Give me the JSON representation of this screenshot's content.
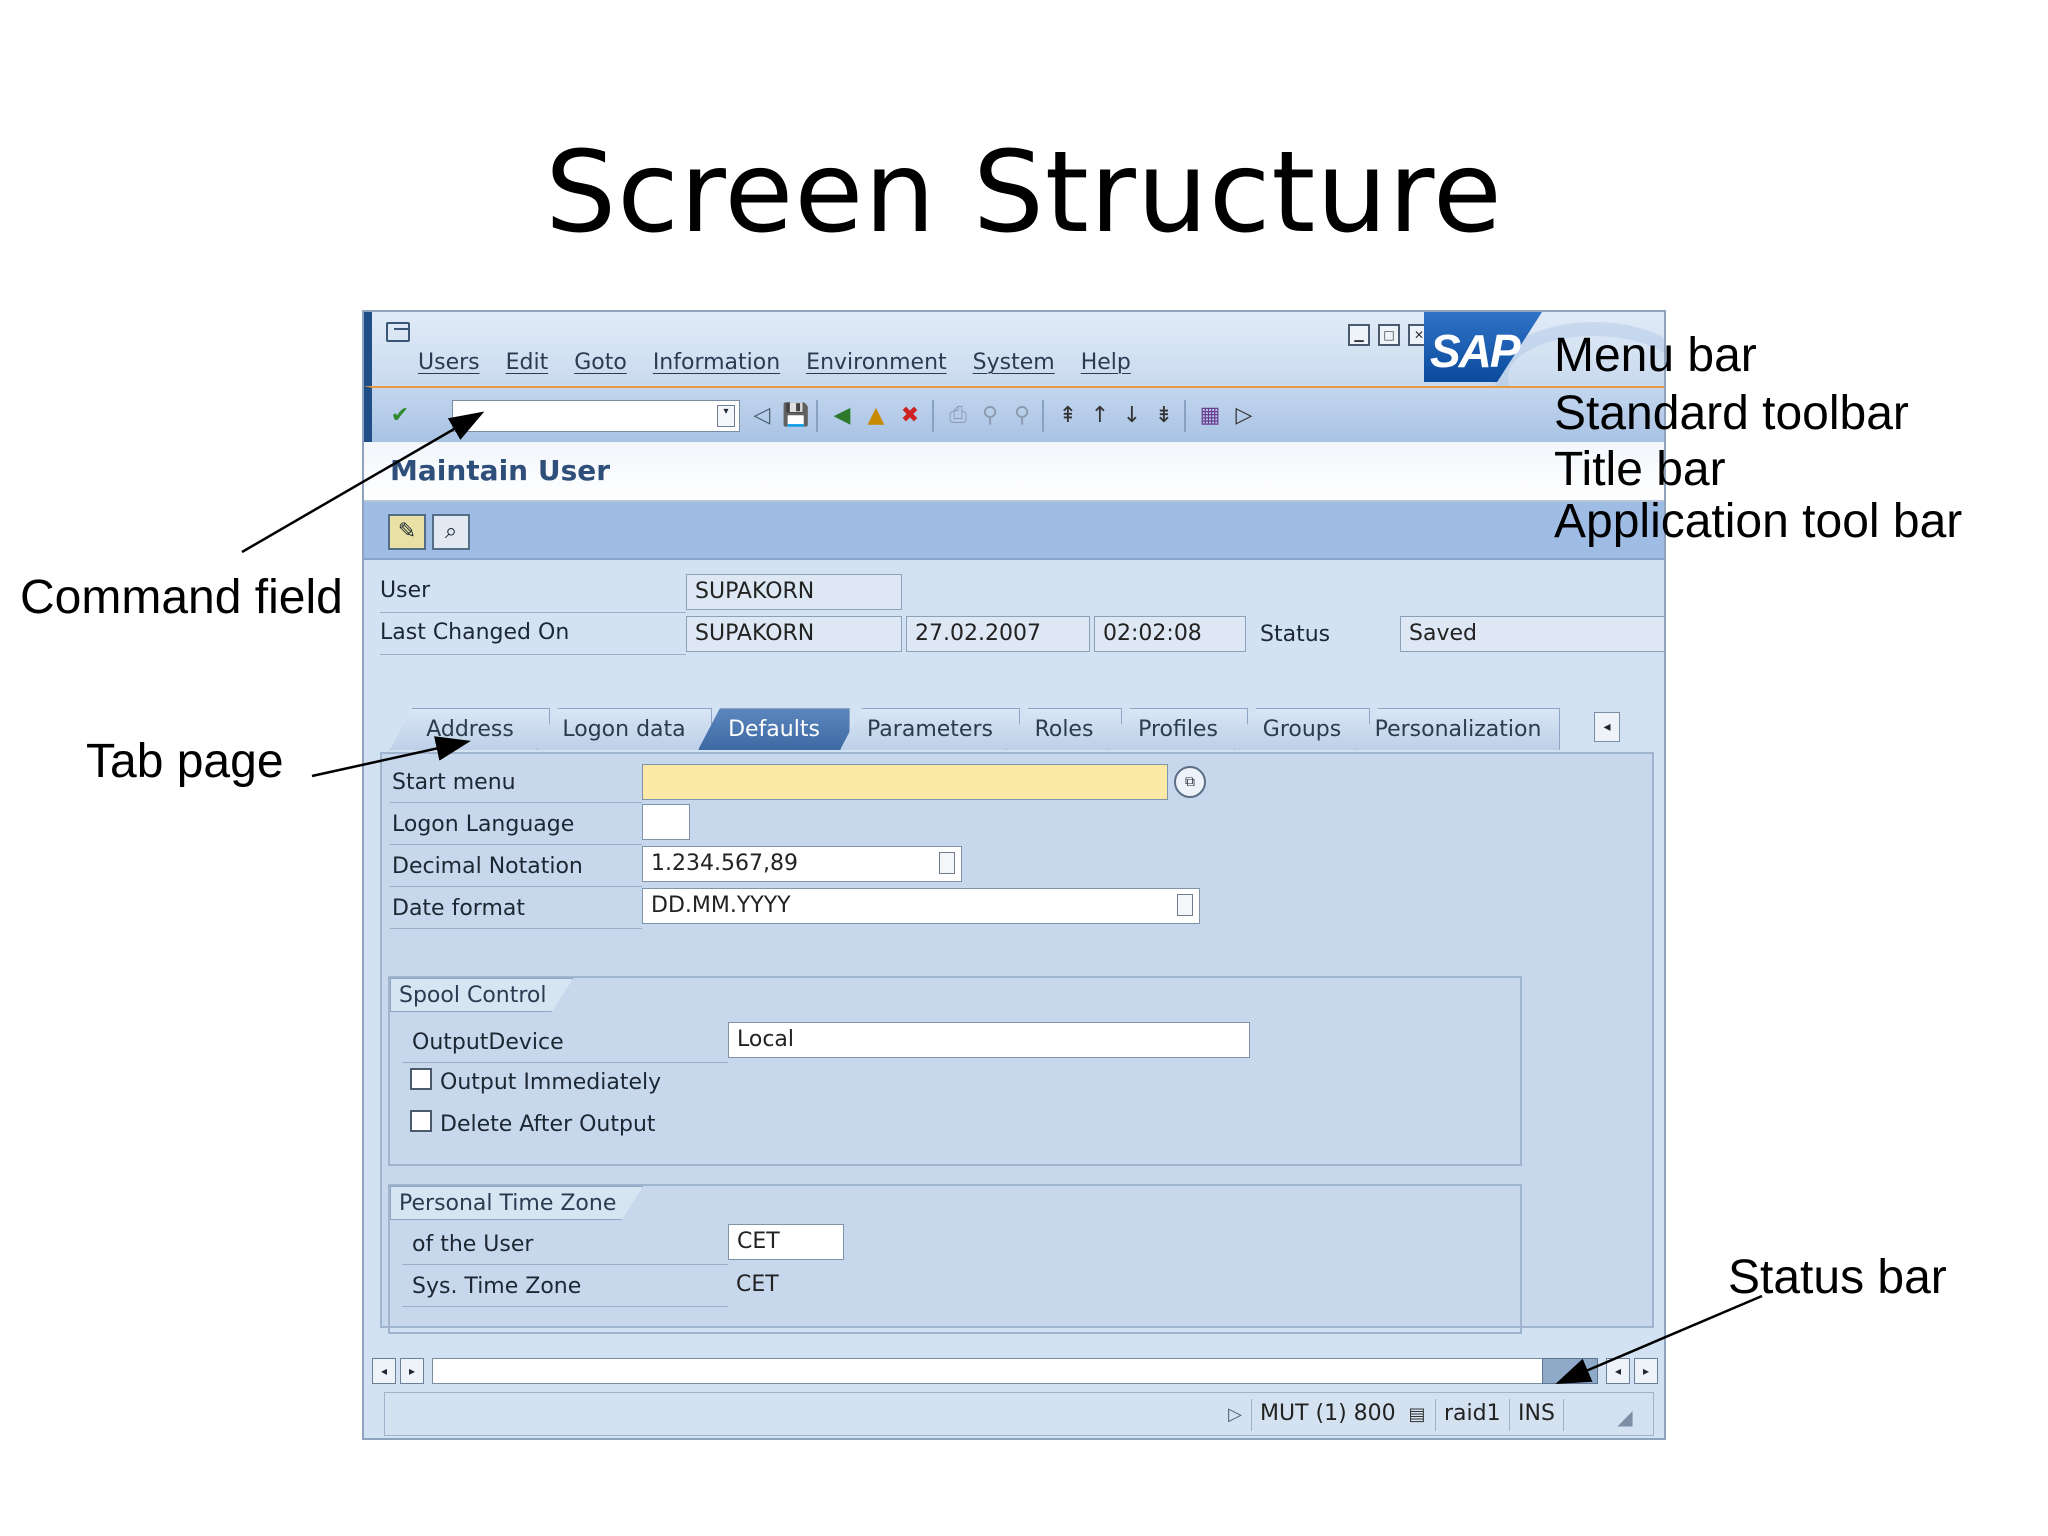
{
  "slide": {
    "title": "Screen Structure"
  },
  "callouts": {
    "menu_bar": "Menu bar",
    "standard_toolbar": "Standard toolbar",
    "title_bar": "Title bar",
    "application_toolbar": "Application tool bar",
    "command_field": "Command field",
    "tab_page": "Tab page",
    "status_bar": "Status bar"
  },
  "sap": {
    "logo": "SAP",
    "menu": [
      "Users",
      "Edit",
      "Goto",
      "Information",
      "Environment",
      "System",
      "Help"
    ],
    "window_title": "Maintain User",
    "header": {
      "user_label": "User",
      "user_value": "SUPAKORN",
      "last_changed_label": "Last Changed On",
      "last_changed_by": "SUPAKORN",
      "date": "27.02.2007",
      "time": "02:02:08",
      "status_label": "Status",
      "status_value": "Saved"
    },
    "tabs": [
      "Address",
      "Logon data",
      "Defaults",
      "Parameters",
      "Roles",
      "Profiles",
      "Groups",
      "Personalization"
    ],
    "active_tab": "Defaults",
    "defaults": {
      "start_menu_label": "Start menu",
      "start_menu_value": "",
      "logon_language_label": "Logon Language",
      "logon_language_value": "",
      "decimal_label": "Decimal Notation",
      "decimal_value": "1.234.567,89",
      "date_format_label": "Date format",
      "date_format_value": "DD.MM.YYYY"
    },
    "spool": {
      "title": "Spool Control",
      "output_device_label": "OutputDevice",
      "output_device_value": "Local",
      "output_immediately": "Output Immediately",
      "delete_after_output": "Delete After Output"
    },
    "timezone": {
      "title": "Personal Time Zone",
      "user_label": "of the User",
      "user_value": "CET",
      "sys_label": "Sys. Time Zone",
      "sys_value": "CET"
    },
    "status_bar": {
      "system": "MUT (1) 800",
      "server": "raid1",
      "mode": "INS"
    }
  }
}
